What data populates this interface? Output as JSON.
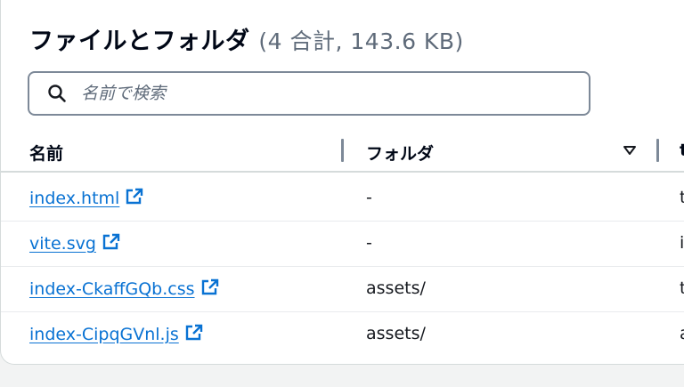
{
  "header": {
    "title": "ファイルとフォルダ",
    "count": "(4 合計, 143.6 KB)"
  },
  "search": {
    "placeholder": "名前で検索",
    "value": ""
  },
  "table": {
    "columns": [
      "名前",
      "フォルダ",
      "t"
    ],
    "rows": [
      {
        "name": "index.html",
        "folder": "-",
        "type": "t"
      },
      {
        "name": "vite.svg",
        "folder": "-",
        "type": "i"
      },
      {
        "name": "index-CkaffGQb.css",
        "folder": "assets/",
        "type": "t"
      },
      {
        "name": "index-CipqGVnl.js",
        "folder": "assets/",
        "type": "a"
      }
    ]
  },
  "colors": {
    "link": "#0972d3",
    "text": "#000716",
    "muted": "#5f6b7a",
    "border": "#d5dbdb"
  },
  "icons": {
    "search": "search-icon",
    "sort": "sort-desc-icon",
    "external": "external-link-icon"
  }
}
